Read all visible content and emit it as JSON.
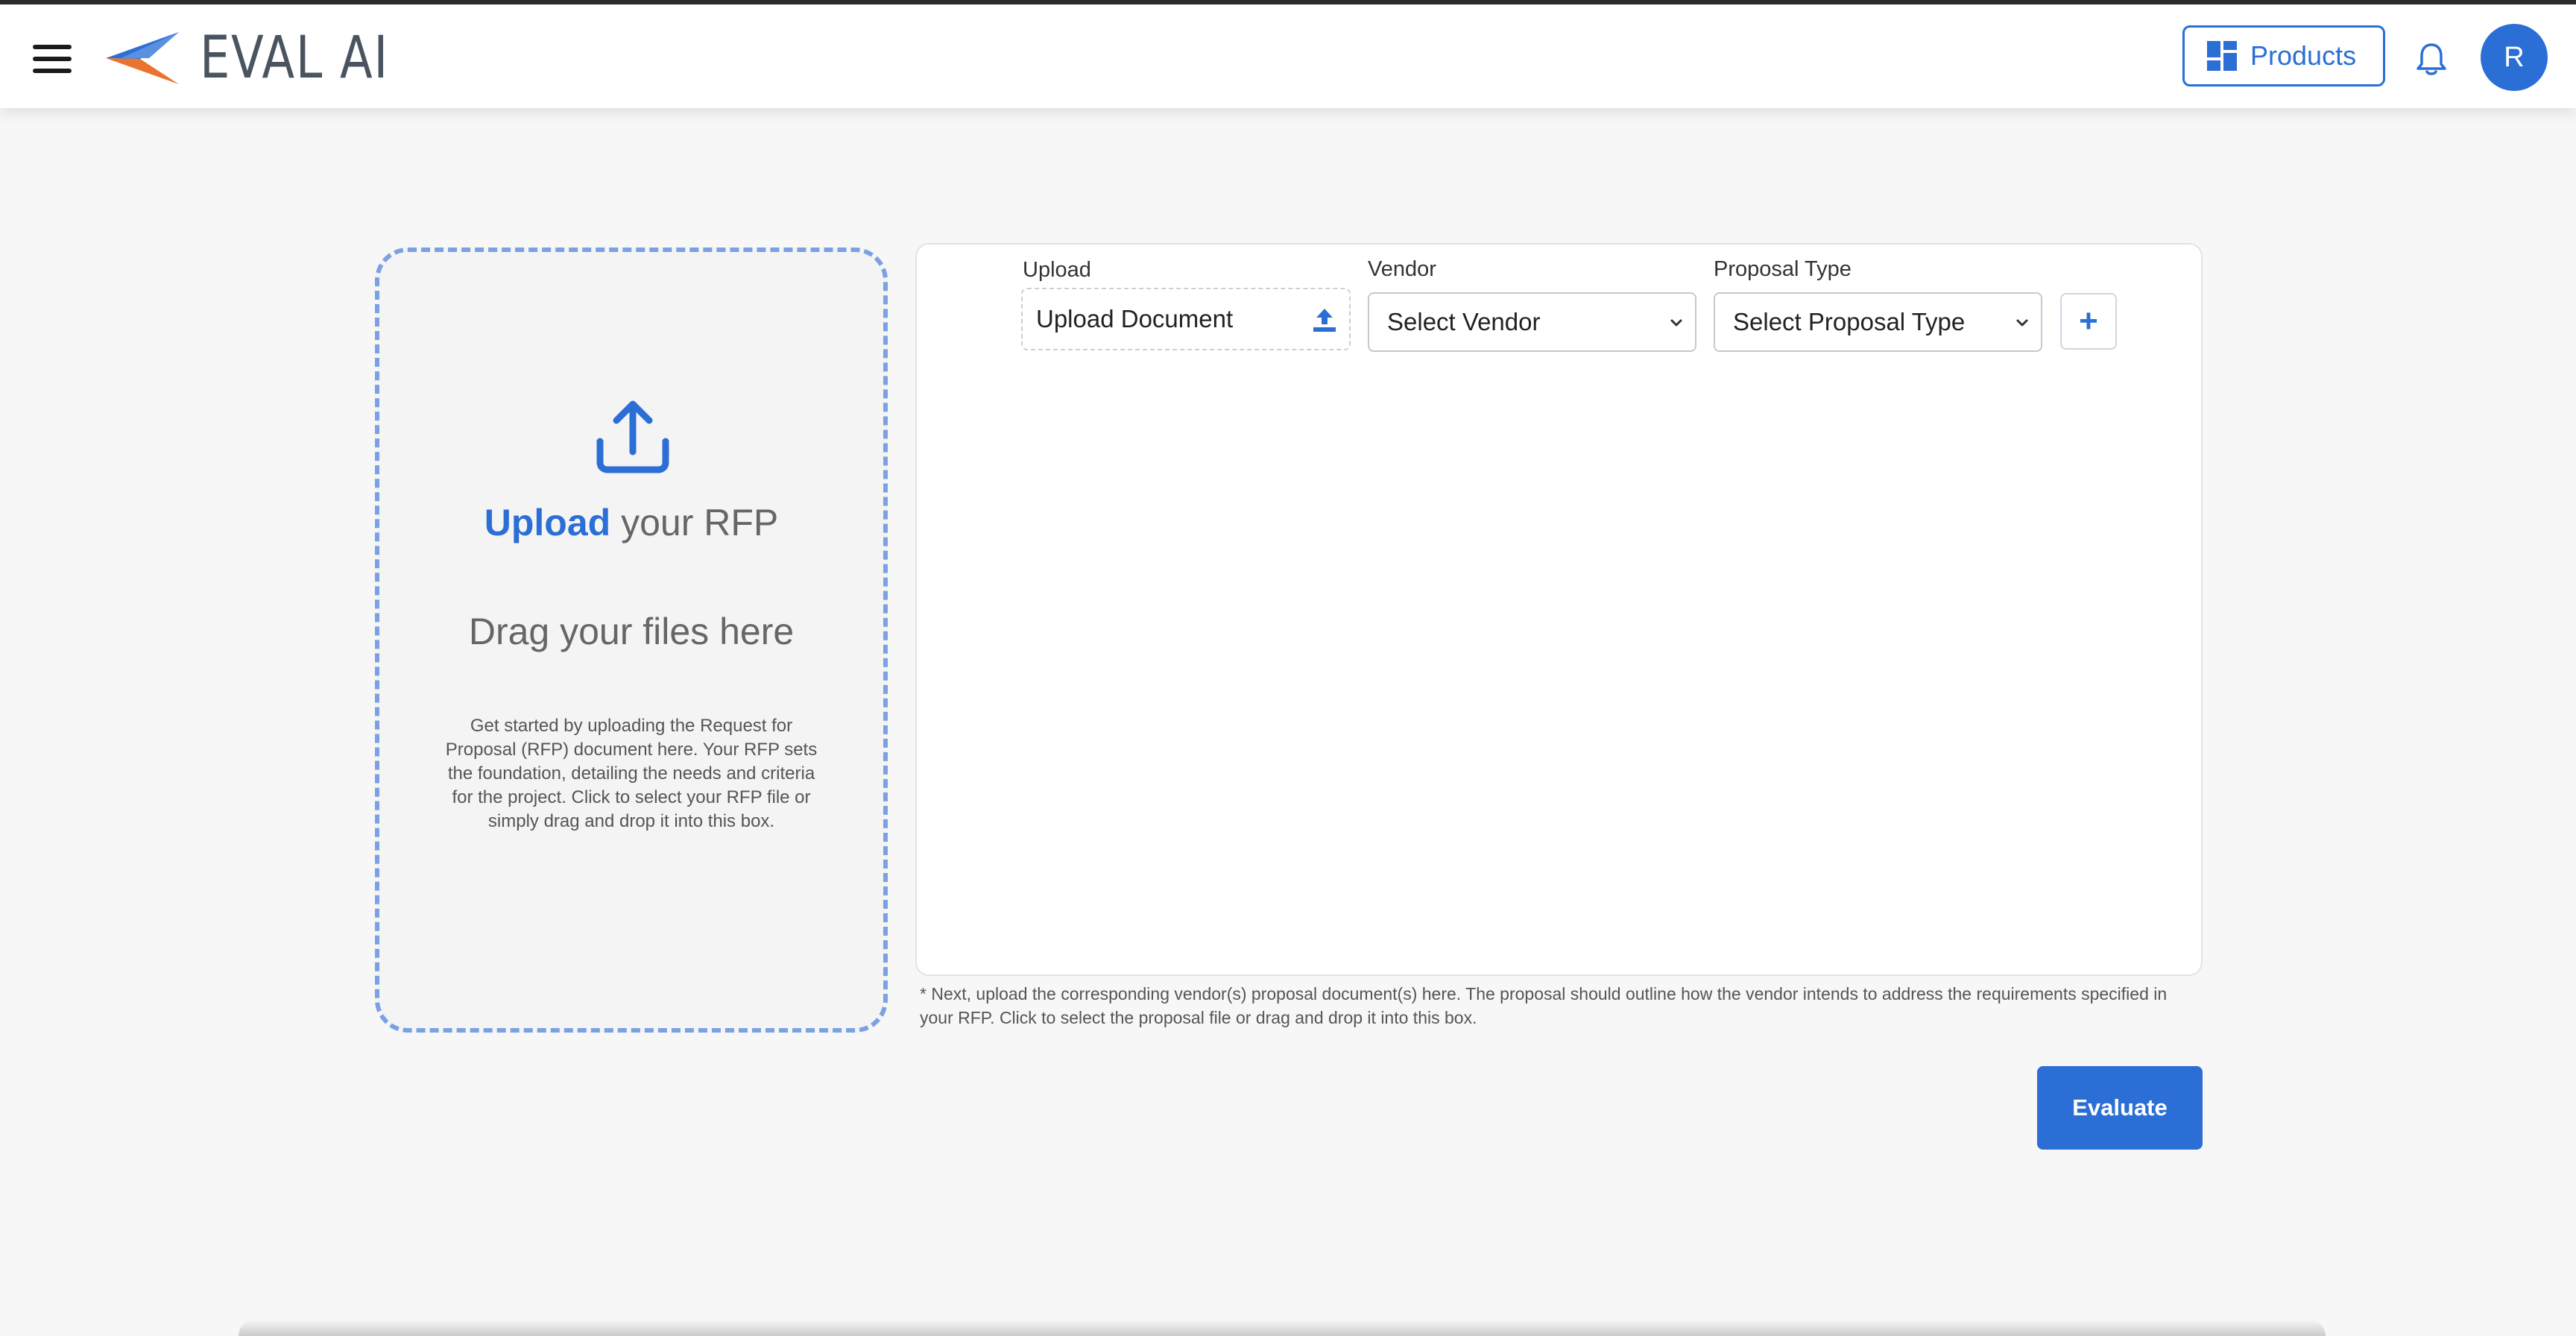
{
  "header": {
    "logo_text": "EVAL AI",
    "products_label": "Products",
    "avatar_initial": "R"
  },
  "rfp": {
    "title_strong": "Upload",
    "title_rest": " your RFP",
    "drag_text": "Drag your files here",
    "description": "Get started by uploading the Request for Proposal (RFP) document here. Your RFP sets the foundation, detailing the needs and criteria for the project. Click to select your RFP file or simply drag and drop it into this box."
  },
  "proposal": {
    "upload_label": "Upload",
    "upload_button": "Upload Document",
    "vendor_label": "Vendor",
    "vendor_value": "Select Vendor",
    "type_label": "Proposal Type",
    "type_value": "Select Proposal Type",
    "add_symbol": "+",
    "footnote": "* Next, upload the corresponding vendor(s) proposal document(s) here. The proposal should outline how the vendor intends to address the requirements specified in your RFP. Click to select the proposal file or drag and drop it into this box."
  },
  "actions": {
    "evaluate_label": "Evaluate"
  },
  "colors": {
    "accent": "#2b6fd6",
    "logo_orange": "#e8742f",
    "logo_blue": "#2b6fd6",
    "dashed_border": "#7aa1e3"
  },
  "icons": {
    "menu": "hamburger-icon",
    "products": "grid-icon",
    "notifications": "bell-icon",
    "upload": "upload-icon"
  }
}
